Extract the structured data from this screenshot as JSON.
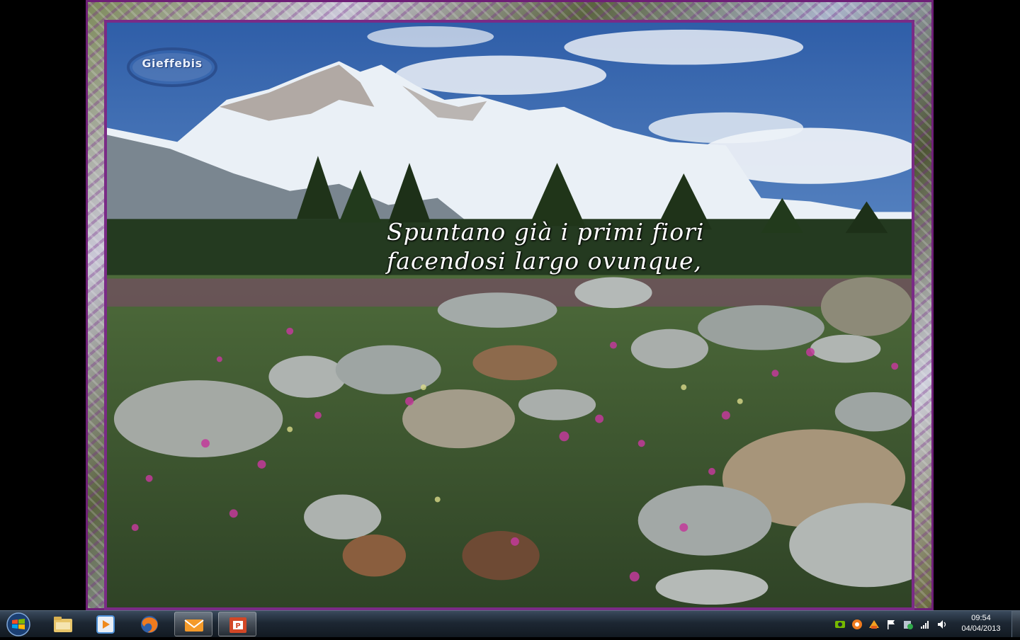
{
  "slideshow": {
    "caption_line1": "Spuntano già i primi fiori",
    "caption_line2": "facendosi largo ovunque,",
    "logo_text": "Gieffebis"
  },
  "taskbar": {
    "start": {
      "icon": "windows-logo-icon"
    },
    "pinned": [
      {
        "name": "windows-explorer",
        "icon": "folder-icon"
      },
      {
        "name": "media-player",
        "icon": "media-player-icon"
      },
      {
        "name": "firefox",
        "icon": "firefox-icon"
      },
      {
        "name": "mail",
        "icon": "mail-envelope-icon"
      },
      {
        "name": "powerpoint-slideshow",
        "icon": "powerpoint-icon"
      }
    ],
    "tray_icons": [
      "nvidia-icon",
      "avast-icon",
      "update-icon",
      "action-center-flag-icon",
      "security-icon",
      "network-signal-icon",
      "volume-icon"
    ],
    "clock_time": "09:54",
    "clock_date": "04/04/2013"
  },
  "colors": {
    "frame_border": "#6e1f77",
    "taskbar": "#1d2733"
  }
}
